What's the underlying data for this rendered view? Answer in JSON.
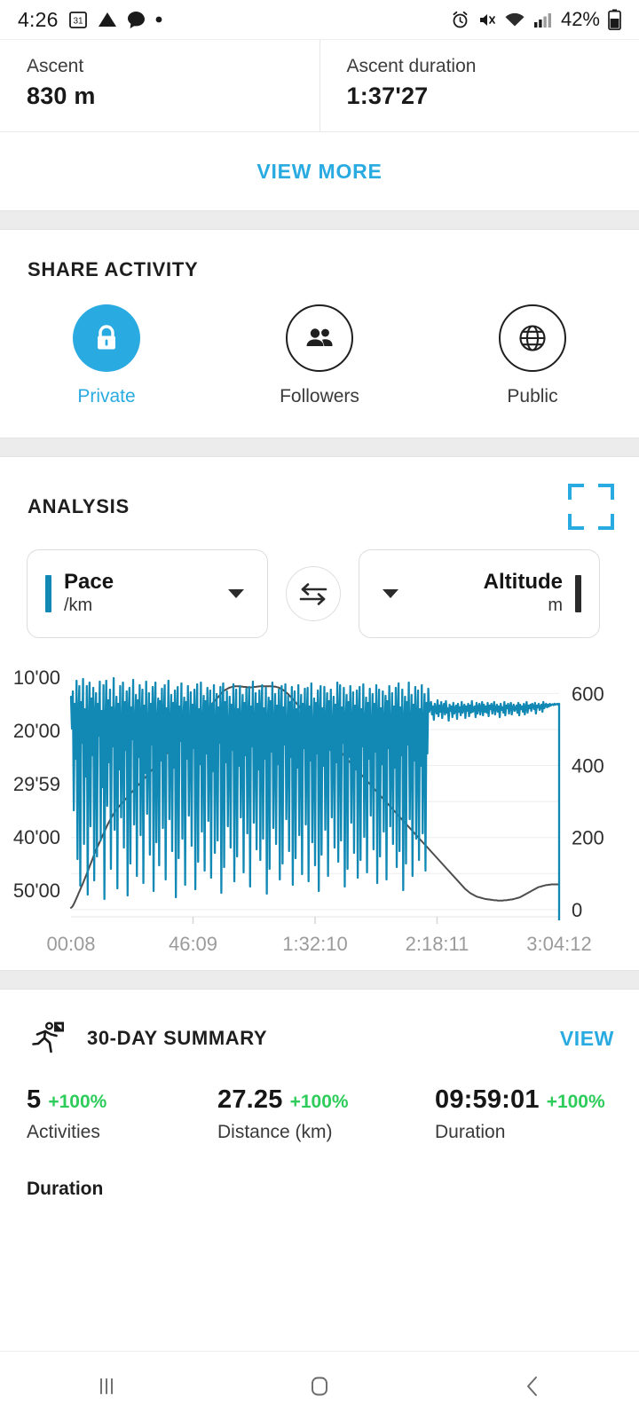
{
  "statusbar": {
    "time": "4:26",
    "battery": "42%",
    "left_icons": [
      "calendar-31-icon",
      "drive-triangle-icon",
      "chat-bubble-icon",
      "dot-icon"
    ],
    "right_icons": [
      "alarm-icon",
      "mute-icon",
      "wifi-icon",
      "signal-icon",
      "battery-icon"
    ]
  },
  "ascent_stats": [
    {
      "label": "Ascent",
      "value": "830 m"
    },
    {
      "label": "Ascent duration",
      "value": "1:37'27"
    }
  ],
  "view_more_label": "VIEW MORE",
  "share": {
    "title": "SHARE ACTIVITY",
    "options": [
      {
        "label": "Private",
        "icon": "lock-icon",
        "selected": true
      },
      {
        "label": "Followers",
        "icon": "people-icon",
        "selected": false
      },
      {
        "label": "Public",
        "icon": "globe-icon",
        "selected": false
      }
    ]
  },
  "analysis": {
    "title": "ANALYSIS",
    "fullscreen_icon": "fullscreen-icon",
    "left_metric": {
      "name": "Pace",
      "unit": "/km",
      "color": "#1189b4"
    },
    "right_metric": {
      "name": "Altitude",
      "unit": "m",
      "color": "#2b2b2b"
    },
    "swap_icon": "swap-arrows-icon"
  },
  "summary": {
    "icon": "running-person-icon",
    "title": "30-DAY SUMMARY",
    "view_label": "VIEW",
    "stats": [
      {
        "value": "5",
        "delta": "+100%",
        "label": "Activities"
      },
      {
        "value": "27.25",
        "delta": "+100%",
        "label": "Distance (km)"
      },
      {
        "value": "09:59:01",
        "delta": "+100%",
        "label": "Duration"
      }
    ],
    "duration_heading": "Duration"
  },
  "navbar": {
    "recents": "recents-icon",
    "home": "home-icon",
    "back": "back-icon"
  },
  "colors": {
    "accent": "#29ABE2",
    "pace": "#1189b4",
    "altitude": "#4d4d4d",
    "positive": "#2ecc5a"
  },
  "chart_data": {
    "type": "line",
    "title": "",
    "xlabel": "",
    "ylabel": "Pace (/km)",
    "grid": true,
    "legend": "none",
    "x_ticks": [
      "00:08",
      "46:09",
      "1:32:10",
      "2:18:11",
      "3:04:12"
    ],
    "left_axis": {
      "label": "Pace",
      "unit": "/km",
      "ticks": [
        "10'00",
        "20'00",
        "29'59",
        "40'00",
        "50'00"
      ],
      "tick_values": [
        600,
        1200,
        1799,
        2400,
        3000
      ],
      "ylim": [
        540,
        3300
      ],
      "inverted": false,
      "color": "#1189b4"
    },
    "right_axis": {
      "label": "Altitude",
      "unit": "m",
      "ticks": [
        "600",
        "400",
        "200",
        "0"
      ],
      "tick_values": [
        600,
        400,
        200,
        0
      ],
      "ylim": [
        -20,
        660
      ],
      "color": "#4d4d4d"
    },
    "series": [
      {
        "name": "Pace",
        "axis": "left",
        "color": "#1189b4",
        "note": "Highly noisy pace trace with frequent spikes between 8'00 and 55'00 /km for the first two thirds, settling to a steady ~8'30-10'00 /km over the final third.",
        "values": [
          820,
          1180,
          760,
          2100,
          900,
          1520,
          640,
          2650,
          1010,
          700,
          2950,
          880,
          1340,
          620,
          2480,
          960,
          1720,
          700,
          3050,
          1120,
          660,
          2280,
          840,
          1480,
          720,
          2890,
          1020,
          780,
          2620,
          900,
          1260,
          650,
          2440,
          980,
          1840,
          690,
          3100,
          1160,
          640,
          2050,
          860,
          1560,
          740,
          2760,
          940,
          1380,
          610,
          2320,
          1080,
          820,
          2980,
          900,
          1640,
          700,
          2180,
          1240,
          660,
          2520,
          880,
          1420,
          760,
          3060,
          1000,
          720,
          2700,
          940,
          1300,
          630,
          2260,
          1140,
          800,
          2840,
          860,
          1500,
          690,
          2380,
          1060,
          740,
          2920,
          920,
          1680,
          650,
          2140,
          1200,
          780,
          2600,
          900,
          1360,
          710,
          3010,
          980,
          660,
          2460,
          1100,
          840,
          2720,
          870,
          1540,
          730,
          2300,
          1020,
          690,
          2880,
          950,
          1440,
          640,
          2200,
          1160,
          800,
          2560,
          890,
          1620,
          750,
          3080,
          1000,
          710,
          2640,
          930,
          1320,
          670,
          2420,
          1090,
          830,
          2940,
          880,
          1520,
          700,
          2160,
          1180,
          770,
          2500,
          910,
          1400,
          740,
          2990,
          1040,
          680,
          2680,
          960,
          1580,
          660,
          2340,
          1120,
          810,
          2780,
          870,
          1460,
          720,
          2220,
          1060,
          750,
          2860,
          900,
          1660,
          690,
          2580,
          1140,
          790,
          2440,
          940,
          1340,
          710,
          3030,
          1010,
          670,
          2740,
          880,
          1560,
          760,
          2280,
          1190,
          820,
          2520,
          910,
          1420,
          680,
          2900,
          1070,
          740,
          2620,
          960,
          1600,
          700,
          2180,
          1130,
          800,
          2800,
          890,
          1480,
          730,
          2360,
          1050,
          710,
          2960,
          930,
          1380,
          650,
          2240,
          1170,
          780,
          2540,
          900,
          1640,
          750,
          2660,
          1000,
          690,
          2420,
          950,
          1520,
          720,
          3040,
          1100,
          830,
          2760,
          870,
          1440,
          660,
          2300,
          1160,
          790,
          2480,
          920,
          1580,
          740,
          2880,
          1030,
          700,
          2700,
          940,
          1360,
          680,
          2200,
          1210,
          810,
          2560,
          880,
          1500,
          710,
          2940,
          1080,
          760,
          2640,
          960,
          1620,
          690,
          2380,
          1140,
          800,
          2820,
          900,
          1400,
          730,
          2260,
          1060,
          720,
          2900,
          930,
          1540,
          670,
          2460,
          1190,
          840,
          2720,
          890,
          1460,
          750,
          3010,
          1020,
          700,
          2600,
          950,
          1600,
          710,
          2320,
          1120,
          780,
          2840,
          870,
          1420,
          740,
          2180,
          1170,
          820,
          2520,
          910,
          1560,
          660,
          2680,
          990,
          690,
          2440,
          940,
          1340,
          720,
          2960,
          1090,
          800,
          2760,
          880,
          1500,
          700,
          2240,
          1150,
          770,
          2580,
          920,
          1640,
          750,
          2860,
          1040,
          710,
          2660,
          960,
          1380,
          680,
          2400,
          1130,
          830,
          2800,
          890,
          1520,
          730,
          2160,
          1200,
          790,
          2540,
          900,
          1440,
          690,
          2920,
          1070,
          740,
          2620,
          950,
          1580,
          760,
          2340,
          1110,
          810,
          2880,
          870,
          1400,
          700,
          2280,
          1180,
          780,
          2480,
          930,
          1620,
          720,
          2740,
          1010,
          670,
          2560,
          940,
          1480,
          740,
          3000,
          1100,
          820,
          2700,
          880,
          1360,
          660,
          2200,
          1160,
          800,
          2840,
          910,
          1540,
          710,
          2420,
          1050,
          750,
          2660,
          960,
          1600,
          690,
          2360,
          1140,
          790,
          2780,
          890,
          1460,
          730,
          990,
          950,
          880,
          1020,
          930,
          1080,
          900,
          970,
          1010,
          860,
          1040,
          920,
          990,
          880,
          1060,
          940,
          900,
          1020,
          870,
          1000,
          950,
          1090,
          910,
          980,
          930,
          1050,
          890,
          1010,
          960,
          920,
          1070,
          900,
          990,
          940,
          1030,
          880,
          1000,
          950,
          910,
          1060,
          930,
          980,
          900,
          1040,
          920,
          1000,
          870,
          990,
          960,
          930,
          1050,
          890,
          1010,
          940,
          900,
          1020,
          950,
          880,
          1030,
          910,
          990,
          930,
          1000,
          890,
          1040,
          920,
          960,
          900,
          1010,
          940,
          880,
          1020,
          950,
          910,
          990,
          930,
          1050,
          900,
          970,
          940,
          1000,
          880,
          1030,
          920,
          950,
          900,
          1010,
          930,
          890,
          1020,
          940,
          910,
          980,
          950,
          920,
          1000,
          890,
          1030,
          910,
          960,
          930,
          990,
          900,
          1020,
          940,
          880,
          1000,
          920,
          950,
          910,
          980,
          900,
          930,
          960,
          890,
          1010,
          920,
          940,
          900,
          970,
          930,
          910,
          990,
          880,
          950,
          920,
          900,
          940,
          910,
          930,
          900,
          920,
          910,
          905,
          915,
          900,
          910,
          905,
          900,
          910,
          900
        ]
      },
      {
        "name": "Altitude",
        "axis": "right",
        "color": "#4d4d4d",
        "note": "Altitude climbs from ~0 m at the start to a ~600 m plateau around 1:40-2:05, then descends steeply after 2:20 back to near 0 m by the end.",
        "values": [
          5,
          8,
          14,
          22,
          30,
          38,
          47,
          55,
          64,
          72,
          81,
          90,
          99,
          108,
          118,
          127,
          136,
          146,
          155,
          164,
          172,
          180,
          188,
          196,
          204,
          212,
          220,
          228,
          236,
          243,
          250,
          256,
          262,
          268,
          273,
          278,
          283,
          288,
          292,
          296,
          300,
          304,
          308,
          312,
          316,
          320,
          324,
          328,
          332,
          336,
          340,
          344,
          348,
          352,
          356,
          360,
          364,
          368,
          372,
          376,
          380,
          384,
          388,
          392,
          396,
          400,
          404,
          408,
          412,
          416,
          420,
          424,
          428,
          432,
          436,
          440,
          444,
          448,
          452,
          456,
          460,
          464,
          468,
          472,
          476,
          480,
          484,
          488,
          492,
          496,
          500,
          504,
          508,
          512,
          516,
          520,
          524,
          528,
          532,
          536,
          540,
          544,
          548,
          552,
          556,
          560,
          564,
          568,
          572,
          576,
          580,
          584,
          588,
          592,
          596,
          600,
          604,
          608,
          610,
          612,
          614,
          616,
          617,
          618,
          619,
          620,
          620,
          620,
          620,
          620,
          619,
          619,
          618,
          618,
          618,
          617,
          617,
          617,
          617,
          618,
          618,
          618,
          619,
          619,
          620,
          620,
          620,
          620,
          620,
          620,
          620,
          620,
          620,
          620,
          620,
          619,
          619,
          618,
          617,
          616,
          614,
          612,
          610,
          607,
          604,
          601,
          598,
          594,
          590,
          586,
          582,
          578,
          574,
          570,
          566,
          562,
          558,
          554,
          550,
          546,
          542,
          538,
          534,
          530,
          526,
          522,
          518,
          514,
          510,
          506,
          502,
          498,
          494,
          490,
          486,
          482,
          478,
          474,
          470,
          466,
          462,
          458,
          454,
          450,
          446,
          442,
          438,
          434,
          430,
          426,
          422,
          418,
          414,
          410,
          406,
          402,
          398,
          394,
          390,
          386,
          382,
          378,
          374,
          370,
          366,
          362,
          358,
          354,
          350,
          346,
          342,
          338,
          334,
          330,
          326,
          322,
          318,
          314,
          310,
          306,
          302,
          298,
          294,
          290,
          286,
          282,
          278,
          274,
          270,
          266,
          262,
          258,
          254,
          250,
          246,
          242,
          238,
          234,
          230,
          226,
          222,
          218,
          214,
          210,
          206,
          202,
          198,
          194,
          190,
          186,
          182,
          178,
          174,
          170,
          166,
          162,
          158,
          154,
          150,
          146,
          142,
          138,
          134,
          130,
          126,
          122,
          118,
          114,
          110,
          106,
          102,
          98,
          94,
          90,
          86,
          82,
          78,
          74,
          70,
          66,
          62,
          58,
          55,
          52,
          49,
          46,
          44,
          42,
          40,
          38,
          36,
          35,
          34,
          33,
          32,
          31,
          30,
          29,
          29,
          28,
          28,
          27,
          27,
          26,
          26,
          26,
          25,
          25,
          25,
          25,
          25,
          26,
          26,
          26,
          27,
          27,
          28,
          28,
          29,
          30,
          31,
          32,
          33,
          34,
          36,
          38,
          40,
          42,
          44,
          46,
          48,
          50,
          52,
          54,
          56,
          58,
          60,
          62,
          63,
          64,
          65,
          66,
          67,
          68,
          68,
          69,
          69,
          70,
          70,
          70,
          70,
          70,
          70,
          70
        ]
      }
    ]
  }
}
